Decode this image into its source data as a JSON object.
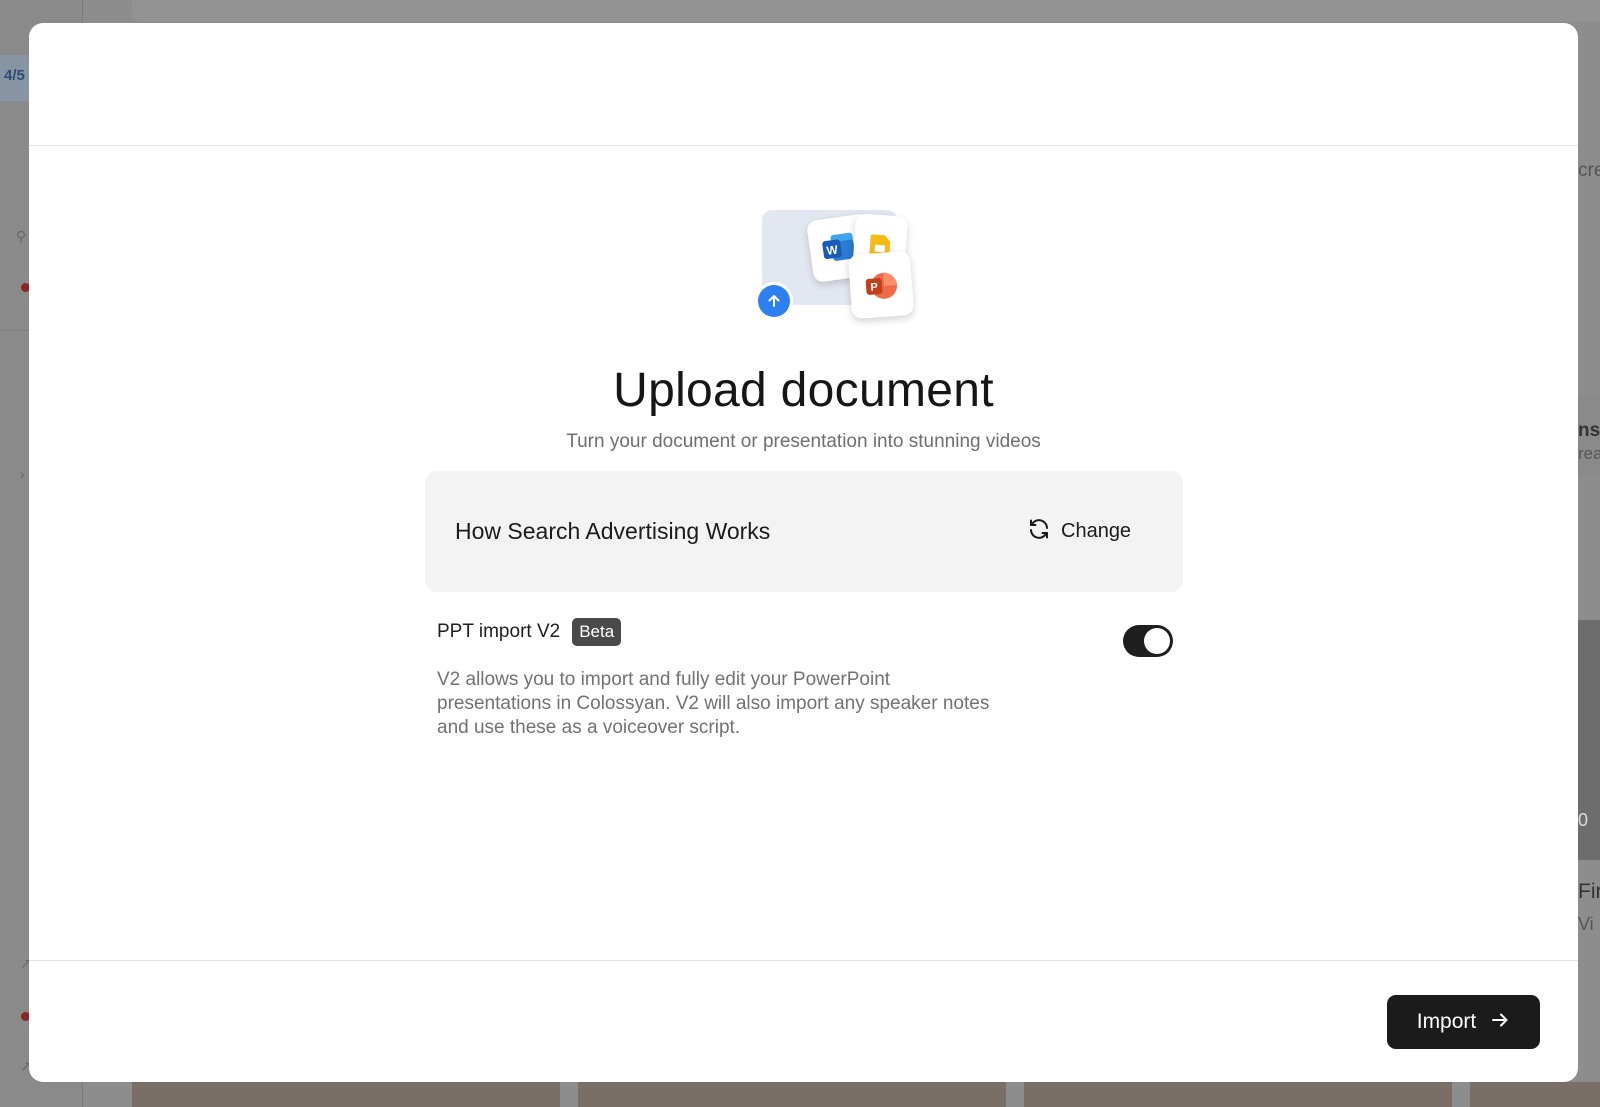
{
  "background": {
    "page_indicator": "4/5",
    "right_fragments": [
      "cre",
      "nst",
      "rea",
      "0",
      "Fir",
      "Vi"
    ]
  },
  "modal": {
    "title": "Upload document",
    "subtitle": "Turn your document or presentation into stunning videos",
    "illustration": {
      "icons": [
        "word-icon",
        "google-slides-icon",
        "powerpoint-icon",
        "upload-arrow-icon"
      ],
      "word_letter": "W",
      "ppt_letter": "P"
    },
    "file": {
      "name": "How Search Advertising Works",
      "change_label": "Change",
      "change_icon": "refresh-icon"
    },
    "ppt_import": {
      "label": "PPT import V2",
      "badge": "Beta",
      "enabled": true,
      "description": "V2 allows you to import and fully edit your PowerPoint presentations in Colossyan. V2 will also import any speaker notes and use these as a voiceover script."
    },
    "footer": {
      "import_label": "Import",
      "import_icon": "arrow-right-icon"
    }
  },
  "colors": {
    "accent_blue": "#2d80f0",
    "button_dark": "#1b1b1b",
    "overlay": "#8d8d8d"
  }
}
